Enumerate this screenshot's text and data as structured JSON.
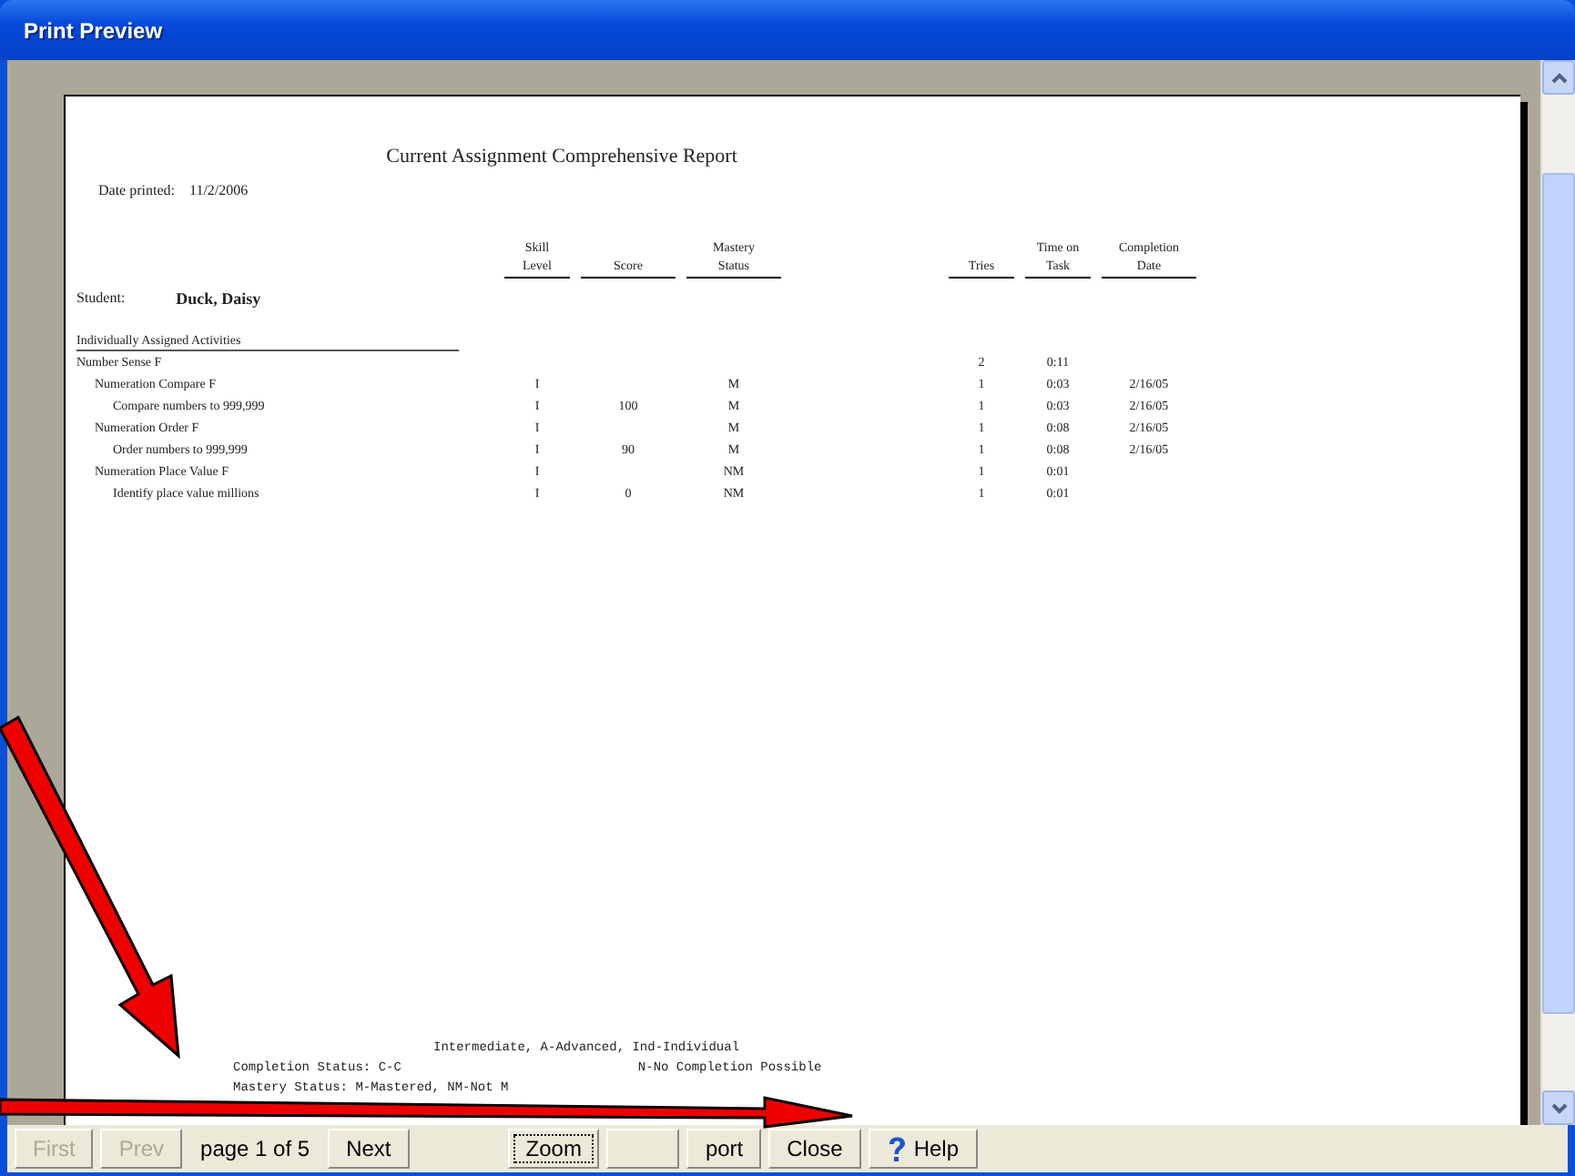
{
  "window": {
    "title": "Print Preview"
  },
  "report": {
    "title": "Current Assignment Comprehensive Report",
    "date_label": "Date printed:",
    "date": "11/2/2006",
    "columns": [
      {
        "label": [
          "Skill",
          "Level"
        ]
      },
      {
        "label": [
          "Score"
        ]
      },
      {
        "label": [
          "Mastery",
          "Status"
        ]
      },
      {
        "label": [
          "Tries"
        ]
      },
      {
        "label": [
          "Time on",
          "Task"
        ]
      },
      {
        "label": [
          "Completion",
          "Date"
        ]
      }
    ],
    "student_label": "Student:",
    "student": "Duck, Daisy",
    "section": "Individually Assigned Activities",
    "rows": [
      {
        "name": "Number Sense F",
        "cells": [
          null,
          null,
          null,
          "2",
          "0:11",
          null
        ],
        "children": [
          {
            "name": "Numeration Compare F",
            "cells": [
              "I",
              null,
              "M",
              "1",
              "0:03",
              "2/16/05"
            ],
            "children": [
              {
                "name": "Compare numbers to 999,999",
                "cells": [
                  "I",
                  "100",
                  "M",
                  "1",
                  "0:03",
                  "2/16/05"
                ]
              }
            ]
          },
          {
            "name": "Numeration Order F",
            "cells": [
              "I",
              null,
              "M",
              "1",
              "0:08",
              "2/16/05"
            ],
            "children": [
              {
                "name": "Order numbers to 999,999",
                "cells": [
                  "I",
                  "90",
                  "M",
                  "1",
                  "0:08",
                  "2/16/05"
                ]
              }
            ]
          },
          {
            "name": "Numeration Place Value F",
            "cells": [
              "I",
              null,
              "NM",
              "1",
              "0:01",
              null
            ],
            "children": [
              {
                "name": "Identify place value millions",
                "cells": [
                  "I",
                  "0",
                  "NM",
                  "1",
                  "0:01",
                  null
                ]
              }
            ]
          }
        ]
      }
    ],
    "legend": [
      [
        "Intermediate, A-Advanced, Ind-Individual"
      ],
      [
        "Completion Status: C-C",
        "N-No Completion Possible"
      ],
      [
        "Mastery Status: M-Mastered, NM-Not M"
      ]
    ]
  },
  "toolbar": [
    {
      "label": "First",
      "disabled": true,
      "kind": "button"
    },
    {
      "label": "Prev",
      "disabled": true,
      "kind": "button"
    },
    {
      "label": "page 1 of 5",
      "kind": "text"
    },
    {
      "label": "Next",
      "disabled": false,
      "kind": "button"
    },
    {
      "label": "Zoom",
      "disabled": false,
      "kind": "button",
      "focused": true
    },
    {
      "kind": "button"
    },
    {
      "label": "port",
      "disabled": false,
      "kind": "button"
    },
    {
      "label": "Close",
      "disabled": false,
      "kind": "button"
    },
    {
      "label": "Help",
      "disabled": false,
      "kind": "help"
    }
  ]
}
